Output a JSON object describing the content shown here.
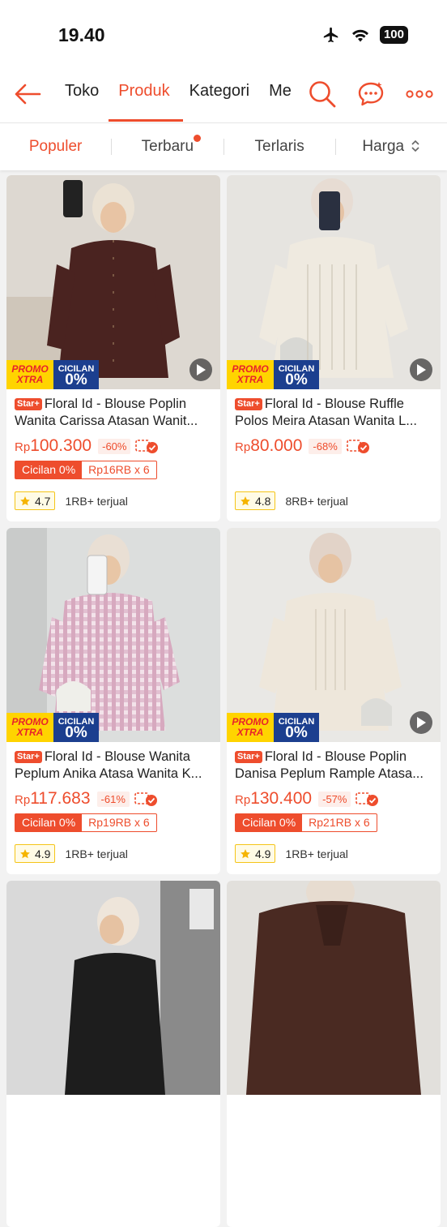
{
  "status_bar": {
    "time": "19.40",
    "battery": "100"
  },
  "nav": {
    "tabs": [
      "Toko",
      "Produk",
      "Kategori",
      "Me"
    ],
    "active_tab": "Produk"
  },
  "sort": {
    "items": [
      "Populer",
      "Terbaru",
      "Terlaris",
      "Harga"
    ],
    "active": "Populer"
  },
  "colors": {
    "accent": "#ee4d2d",
    "promo_yellow": "#ffd400",
    "promo_blue": "#1c3f8f"
  },
  "promo": {
    "promo_line1": "PROMO",
    "promo_line2": "XTRA",
    "cicilan_line1": "CICILAN",
    "cicilan_line2": "0%"
  },
  "products": [
    {
      "badge": "Star+",
      "title": "Floral Id - Blouse Poplin Wanita Carissa Atasan Wanit...",
      "currency": "Rp",
      "price": "100.300",
      "discount": "-60%",
      "installment_label": "Cicilan 0%",
      "installment_value": "Rp16RB x 6",
      "rating": "4.7",
      "sold": "1RB+ terjual"
    },
    {
      "badge": "Star+",
      "title": "Floral Id - Blouse Ruffle Polos Meira Atasan Wanita L...",
      "currency": "Rp",
      "price": "80.000",
      "discount": "-68%",
      "installment_label": "",
      "installment_value": "",
      "rating": "4.8",
      "sold": "8RB+ terjual"
    },
    {
      "badge": "Star+",
      "title": "Floral Id - Blouse Wanita Peplum Anika Atasa Wanita K...",
      "currency": "Rp",
      "price": "117.683",
      "discount": "-61%",
      "installment_label": "Cicilan 0%",
      "installment_value": "Rp19RB x 6",
      "rating": "4.9",
      "sold": "1RB+ terjual"
    },
    {
      "badge": "Star+",
      "title": "Floral Id - Blouse Poplin Danisa Peplum Rample Atasa...",
      "currency": "Rp",
      "price": "130.400",
      "discount": "-57%",
      "installment_label": "Cicilan 0%",
      "installment_value": "Rp21RB x 6",
      "rating": "4.9",
      "sold": "1RB+ terjual"
    }
  ]
}
